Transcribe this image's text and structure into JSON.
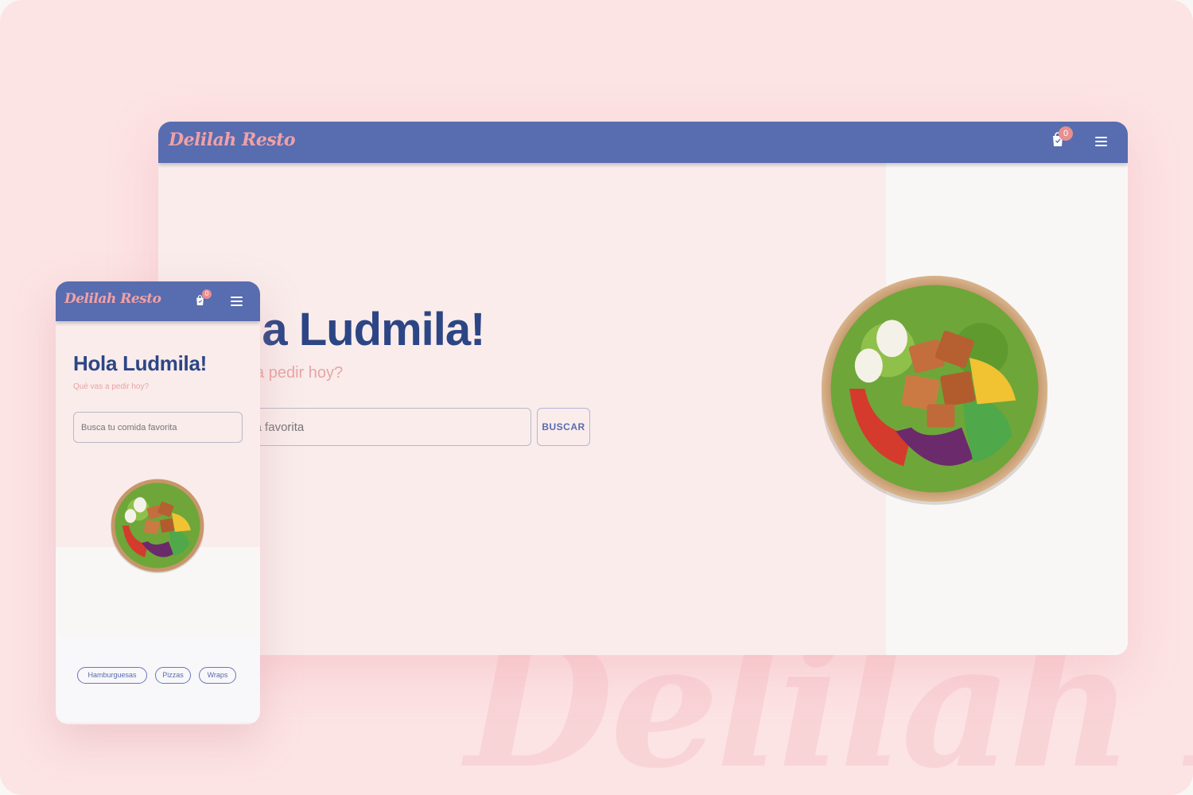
{
  "background": {
    "watermark": "Delilah Re",
    "color": "#fce3e4"
  },
  "desktop": {
    "brand": "Delilah Resto",
    "cart_count": "0",
    "hero_title": "Hola Ludmila!",
    "hero_subtitle": "Qué vas a pedir hoy?",
    "search_placeholder": "Busca tu comida favorita",
    "search_button": "BUSCAR",
    "navbar_color": "#586cb0",
    "brand_color": "#f0a1a6",
    "title_color": "#2c4585"
  },
  "mobile": {
    "brand": "Delilah Resto",
    "cart_count": "0",
    "hero_title": "Hola Ludmila!",
    "hero_subtitle": "Qué vas a pedir hoy?",
    "search_placeholder": "Busca tu comida favorita",
    "categories": [
      "Hamburguesas",
      "Pizzas",
      "Wraps"
    ]
  },
  "icons": {
    "cart": "shopping-bag-icon",
    "menu": "hamburger-menu-icon"
  }
}
